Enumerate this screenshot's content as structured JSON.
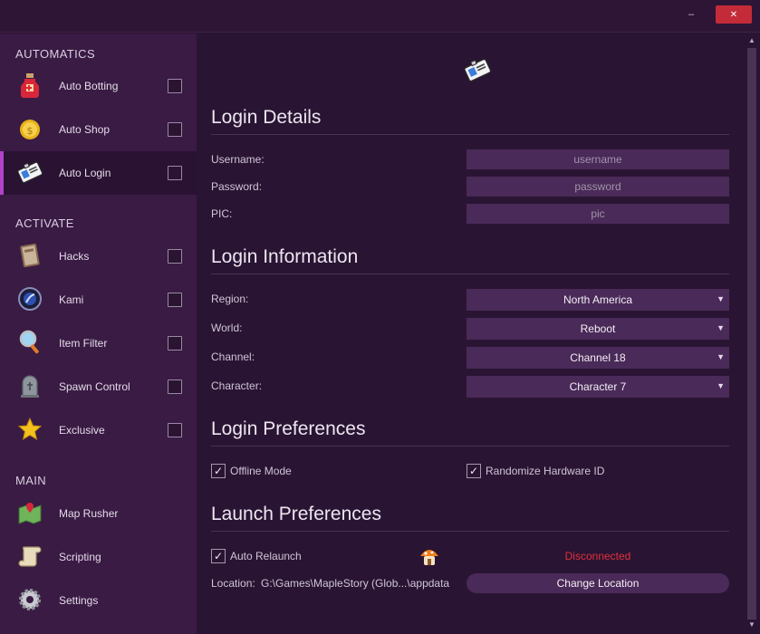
{
  "window": {
    "minimize_label": "–",
    "close_label": "✕"
  },
  "sidebar": {
    "sections": [
      {
        "title": "AUTOMATICS",
        "items": [
          {
            "label": "Auto Botting",
            "icon": "potion-icon",
            "checked": false
          },
          {
            "label": "Auto Shop",
            "icon": "coin-icon",
            "checked": false
          },
          {
            "label": "Auto Login",
            "icon": "id-card-icon",
            "checked": false,
            "active": true
          }
        ]
      },
      {
        "title": "ACTIVATE",
        "items": [
          {
            "label": "Hacks",
            "icon": "book-icon",
            "checked": false
          },
          {
            "label": "Kami",
            "icon": "kami-orb-icon",
            "checked": false
          },
          {
            "label": "Item Filter",
            "icon": "magnifier-icon",
            "checked": false
          },
          {
            "label": "Spawn Control",
            "icon": "tombstone-icon",
            "checked": false
          },
          {
            "label": "Exclusive",
            "icon": "star-icon",
            "checked": false
          }
        ]
      },
      {
        "title": "MAIN",
        "items": [
          {
            "label": "Map Rusher",
            "icon": "map-icon"
          },
          {
            "label": "Scripting",
            "icon": "scroll-icon"
          },
          {
            "label": "Settings",
            "icon": "gear-icon"
          }
        ]
      }
    ]
  },
  "main": {
    "header_icon": "id-card-icon",
    "login_details": {
      "title": "Login Details",
      "username_label": "Username:",
      "username_placeholder": "username",
      "password_label": "Password:",
      "password_placeholder": "password",
      "pic_label": "PIC:",
      "pic_placeholder": "pic"
    },
    "login_information": {
      "title": "Login Information",
      "region_label": "Region:",
      "region_value": "North America",
      "world_label": "World:",
      "world_value": "Reboot",
      "channel_label": "Channel:",
      "channel_value": "Channel 18",
      "character_label": "Character:",
      "character_value": "Character 7",
      "dropdown_arrow": "▼"
    },
    "login_preferences": {
      "title": "Login Preferences",
      "offline_mode_label": "Offline Mode",
      "offline_mode_checked": true,
      "randomize_hwid_label": "Randomize Hardware ID",
      "randomize_hwid_checked": true
    },
    "launch_preferences": {
      "title": "Launch Preferences",
      "auto_relaunch_label": "Auto Relaunch",
      "auto_relaunch_checked": true,
      "status_icon": "mushroom-house-icon",
      "status_text": "Disconnected",
      "location_label": "Location:",
      "location_value": "G:\\Games\\MapleStory (Glob...\\appdata",
      "change_location_label": "Change Location"
    },
    "check_mark": "✓"
  },
  "colors": {
    "sidebar_bg": "#3a1b44",
    "main_bg": "#2a1433",
    "accent": "#b044c8",
    "input_bg": "#4a2a58",
    "status_error": "#e0303a",
    "close_button": "#c42b38"
  }
}
